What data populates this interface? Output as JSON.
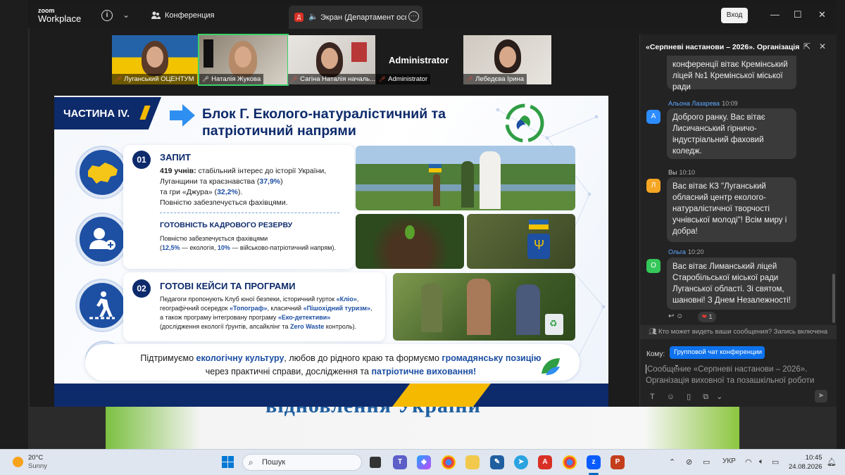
{
  "desktop": {
    "bg_text": "відновлення України"
  },
  "zoom": {
    "logo_line1": "zoom",
    "logo_line2": "Workplace",
    "meeting_label": "Конференция",
    "share_tab": "Экран (Департамент освіти",
    "share_badge": "Д",
    "login_button": "Вход"
  },
  "participants": [
    {
      "name": "Луганський ОЦЕНТУМ"
    },
    {
      "name": "Наталія Жукова"
    },
    {
      "name": "Сагіна Наталія началь..."
    },
    {
      "name": "Administrator",
      "big_name": "Administrator"
    },
    {
      "name": "Лебедєва Ірина"
    }
  ],
  "slide": {
    "part": "ЧАСТИНА IV.",
    "title": "Блок Г. Еколого-натуралістичний та патріотичний напрями",
    "s1": {
      "num": "01",
      "heading": "ЗАПИТ",
      "count": "419 учнів:",
      "line1": " стабільний інтерес до історії України,",
      "line2a": "Луганщини та краєзнавства (",
      "pct1": "37,9%",
      "line2b": ")",
      "line3a": "та гри «Джура» (",
      "pct2": "32,2%",
      "line3b": ").",
      "line4": "Повністю забезпечується фахівцями."
    },
    "s1b": {
      "heading": "ГОТОВНІСТЬ КАДРОВОГО РЕЗЕРВУ",
      "line1": "Повністю забезпечується фахівцями",
      "line2a": "(",
      "p1": "12,5%",
      "line2b": " — екологія, ",
      "p2": "10%",
      "line2c": " — військово-патріотичний напрям)."
    },
    "s2": {
      "num": "02",
      "heading": "ГОТОВІ КЕЙСИ ТА ПРОГРАМИ",
      "l1a": "Педагоги пропонують Клуб юної безпеки, історичний гурток ",
      "k1": "«Кліо»",
      "l1b": ",",
      "l2a": "географічний осередок ",
      "k2": "«Топограф»",
      "l2b": ", класичний ",
      "k3": "«Пішохідний туризм»",
      "l2c": ",",
      "l3a": "а також програму інтегровану програму ",
      "k4": "«Еко-детективи»",
      "l4a": "(дослідження екології ґрунтів, апсайклінг та ",
      "k5": "Zero Waste",
      "l4b": " контроль)."
    },
    "footer": {
      "a": "Підтримуємо ",
      "b": "екологічну культуру",
      "c": ", любов до рідного краю та формуємо ",
      "d": "громадянську позицію",
      "e": "через практичні справи, дослідження та ",
      "f": "патріотичне виховання!"
    }
  },
  "chat": {
    "title": "«Серпневі настанови – 2026». Організація",
    "messages": [
      {
        "text": "конференції вітає Кремінський ліцей №1 Кремінської міської ради"
      },
      {
        "author": "Альона Лазарева",
        "time": "10:09",
        "avatar": "А",
        "avatar_color": "#2d8cff",
        "text": "Доброго ранку. Вас вітає Лисичанський гірничо-індустріальний фаховий коледж."
      },
      {
        "author": "Вы",
        "time": "10:10",
        "avatar": "Л",
        "avatar_color": "#f5a623",
        "text": "Вас вітає КЗ \"Луганський обласний центр еколого-натуралістичної творчості учнівської молоді\"! Всім миру і добра!"
      },
      {
        "author": "Ольга",
        "time": "10:20",
        "avatar": "О",
        "avatar_color": "#34c759",
        "text": "Вас вітає Лиманський ліцей Старобільської міської ради Луганської області. Зі святом, шановні! З Днем Незалежності!"
      }
    ],
    "reaction_count": "1",
    "who_can_see": "Кто может видеть ваши сообщения? Запись включена",
    "to_label": "Кому:",
    "to_value": "Групповой чат конференции",
    "composer_placeholder": "Сообщение «Серпневі настанови – 2026». Організація виховної та позашкільної роботи"
  },
  "taskbar": {
    "temp": "20°C",
    "weather": "Sunny",
    "search": "Пошук",
    "lang": "УКР",
    "time": "10:45",
    "date": "24.08.2026"
  }
}
